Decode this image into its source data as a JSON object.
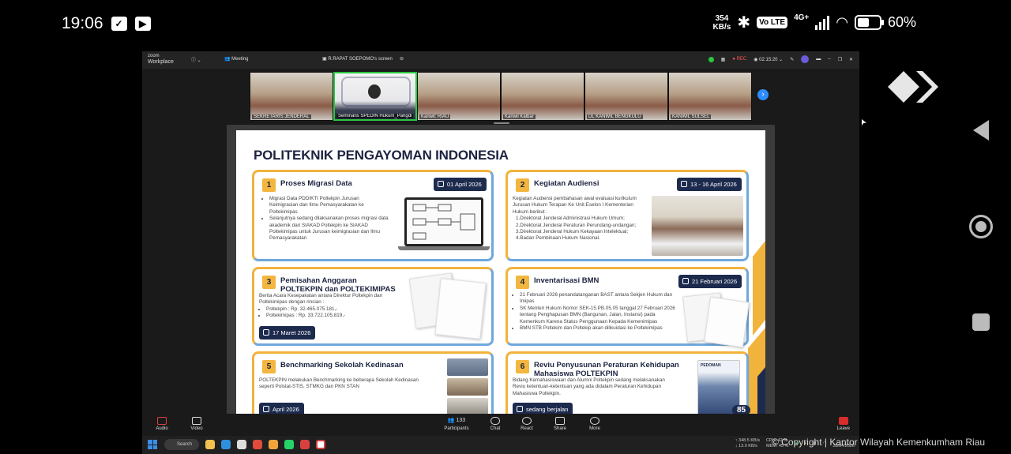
{
  "status_bar": {
    "time": "19:06",
    "net_speed_value": "354",
    "net_speed_unit": "KB/s",
    "volte": "Vo LTE",
    "network": "4G+",
    "battery": "60%"
  },
  "zoom": {
    "brand_top": "zoom",
    "brand_bottom": "Workplace",
    "tab_meeting": "Meeting",
    "tab_share": "R.RAPAT SOEPOMO's screen",
    "rec_label": "REC",
    "timer": "02:15:20",
    "thumbnails": [
      "SEKRETARIS JENDERAL",
      "Seminaris SPEDIN Hukum_Pangdi",
      "Kanwil: RIAU",
      "Kanwil Kalbar",
      "DL KANWIL BENGKULU",
      "KANWIL SULSEL"
    ],
    "toolbar": {
      "audio": "Audio",
      "video": "Video",
      "participants": "Participants",
      "participants_count": "133",
      "chat": "Chat",
      "react": "React",
      "share": "Share",
      "more": "More",
      "leave": "Leave"
    }
  },
  "slide": {
    "title": "POLITEKNIK PENGAYOMAN INDONESIA",
    "page_number": "85",
    "cards": [
      {
        "number": "1",
        "title": "Proses Migrasi Data",
        "date": "01 April 2026",
        "bullets": [
          "Migrasi Data PDDIKTI Poltekpin Jurusan Keimigrasian dan Ilmu Pemasyarakatan ke Poltekimipas",
          "Selanjutnya sedang dilaksanakan proses migrasi data akademik dari SIAKAD Poltekpin ke SIAKAD Poltekimipas untuk Jurusan keimigrasian dan Ilmu Pemasyarakatan"
        ]
      },
      {
        "number": "2",
        "title": "Kegiatan Audiensi",
        "date": "13 - 16 April 2026",
        "intro": "Kegiatan Audiensi pembahasan awal evaluasi kurikulum Jurusan Hukum Terapan Ke Unit Eselon I Kementerian Hukum berikut :",
        "items": [
          "1.Direktorat Jenderal Administrasi Hukum Umum;",
          "2.Direktorat Jenderal Peraturan Perundang-undangan;",
          "3.Direktorat Jenderal Hukum Kekayaan Intelektual;",
          "4.Badan Pembinaan Hukum Nasional."
        ]
      },
      {
        "number": "3",
        "title_line1": "Pemisahan Anggaran",
        "title_line2": "POLTEKPIN dan POLTEKIMIPAS",
        "date": "17 Maret 2026",
        "intro": "Berita Acara Kesepakatan antara Direktur Poltekpin dan Poltekimipas dengan rincian :",
        "bullets": [
          "Poltekpin : Rp. 32.465.075.181,-",
          "Poltekimipas : Rp. 33.722.105.819,-"
        ]
      },
      {
        "number": "4",
        "title": "Inventarisasi BMN",
        "date": "21 Februari 2026",
        "bullets": [
          "21 Februari 2026 penandatanganan BAST antara Sekjen Hukum dan Imipas",
          "SK Menteri Hukum Nomor SEK-15.PB.05.05 tanggal 27 Februari 2026 tentang Penghapusan BMN (Bangunan, Jalan, Instansi) pada Kemenkum Karena Status Penggunaan Kepada Kemenimipas",
          "BMN STB Poltekim dan Poltekip akan dilikuidasi ke Poltekimipas"
        ]
      },
      {
        "number": "5",
        "title": "Benchmarking Sekolah Kedinasan",
        "date": "April 2026",
        "text": "POLTEKPIN melakukan Benchmarking ke beberapa Sekolah Kedinasan seperti Polstat-STIS, STMKG dan PKN STAN"
      },
      {
        "number": "6",
        "title_line1": "Reviu Penyusunan Peraturan Kehidupan",
        "title_line2": "Mahasiswa POLTEKPIN",
        "date": "sedang berjalan",
        "text": "Bidang Kemahasiswaan dan Alumni Poltekpin sedang melaksanakan Reviu ketentuan-ketentuan yang ada didalam Peraturan Kehidupan Mahasiswa Poltekpin.",
        "book_label": "PEDOMAN"
      }
    ]
  },
  "taskbar": {
    "search": "Search",
    "net_up": "↑ 348.5 KB/s",
    "net_down": "↓ 13.0 KB/s",
    "cpu": "CPU: 42 %",
    "mem": "MEM: 45 %",
    "date": "28/04/2026"
  },
  "watermark": "© Copyright | Kantor Wilayah Kemenkumham Riau",
  "colors": {
    "card_border_gold": "#f2b33c",
    "card_border_blue": "#6fa8dc",
    "navy": "#1c2a4d",
    "active_speaker": "#28c840"
  }
}
